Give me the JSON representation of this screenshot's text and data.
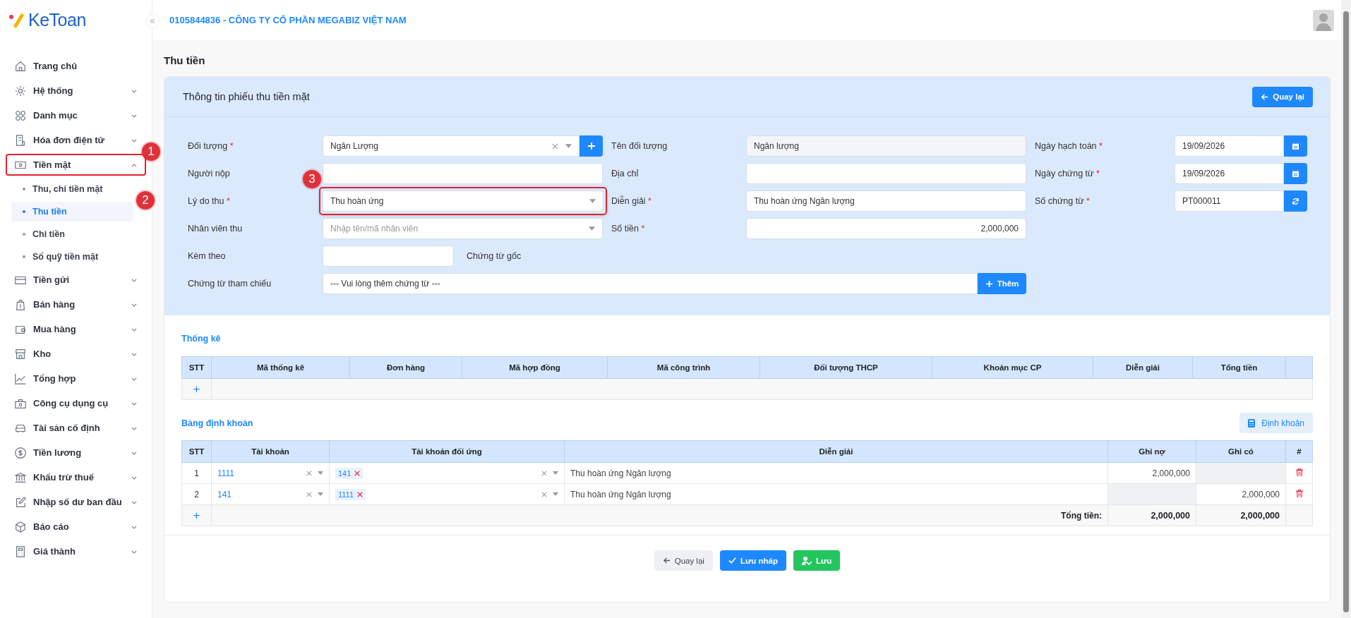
{
  "logo": {
    "text": "KeToan"
  },
  "company": "0105844836 - CÔNG TY CỔ PHẦN MEGABIZ VIỆT NAM",
  "sidebar": {
    "items": [
      {
        "label": "Trang chủ",
        "kind": "link"
      },
      {
        "label": "Hệ thống",
        "kind": "group",
        "expanded": false
      },
      {
        "label": "Danh mục",
        "kind": "group",
        "expanded": false
      },
      {
        "label": "Hóa đơn điện tử",
        "kind": "group",
        "expanded": false
      },
      {
        "label": "Tiền mặt",
        "kind": "group",
        "expanded": true,
        "callout": "1",
        "children": [
          {
            "label": "Thu, chi tiền mặt",
            "selected": false
          },
          {
            "label": "Thu tiền",
            "selected": true,
            "callout": "2"
          },
          {
            "label": "Chi tiền",
            "selected": false
          },
          {
            "label": "Sổ quỹ tiền mặt",
            "selected": false
          }
        ]
      },
      {
        "label": "Tiền gửi",
        "kind": "group",
        "expanded": false
      },
      {
        "label": "Bán hàng",
        "kind": "group",
        "expanded": false
      },
      {
        "label": "Mua hàng",
        "kind": "group",
        "expanded": false
      },
      {
        "label": "Kho",
        "kind": "group",
        "expanded": false
      },
      {
        "label": "Tổng hợp",
        "kind": "group",
        "expanded": false
      },
      {
        "label": "Công cụ dụng cụ",
        "kind": "group",
        "expanded": false
      },
      {
        "label": "Tài sản cố định",
        "kind": "group",
        "expanded": false
      },
      {
        "label": "Tiền lương",
        "kind": "group",
        "expanded": false
      },
      {
        "label": "Khấu trừ thuế",
        "kind": "group",
        "expanded": false
      },
      {
        "label": "Nhập số dư ban đầu",
        "kind": "group",
        "expanded": false
      },
      {
        "label": "Báo cáo",
        "kind": "group",
        "expanded": false
      },
      {
        "label": "Giá thành",
        "kind": "group",
        "expanded": false
      }
    ]
  },
  "page_title": "Thu tiền",
  "card": {
    "title": "Thông tin phiếu thu tiền mặt",
    "back_button": "Quay lại"
  },
  "form": {
    "required_mark": "*",
    "rows": [
      [
        {
          "label": "Đối tượng",
          "required": true,
          "kind": "select_add",
          "value": "Ngân Lượng"
        },
        {
          "label": "Tên đối tượng",
          "required": false,
          "kind": "readonly",
          "value": "Ngân lượng"
        },
        {
          "label": "Ngày hạch toán",
          "required": true,
          "kind": "date",
          "value": "19/09/2026"
        }
      ],
      [
        {
          "label": "Người nộp",
          "required": false,
          "kind": "text"
        },
        {
          "label": "Địa chỉ",
          "required": false,
          "kind": "text"
        },
        {
          "label": "Ngày chứng từ",
          "required": true,
          "kind": "date",
          "value": "19/09/2026"
        }
      ],
      [
        {
          "label": "Lý do thu",
          "required": true,
          "kind": "select",
          "value": "Thu hoàn ứng",
          "callout": "3"
        },
        {
          "label": "Diễn giải",
          "required": true,
          "kind": "text",
          "value": "Thu hoàn ứng Ngân lượng"
        },
        {
          "label": "Số chứng từ",
          "required": true,
          "kind": "code",
          "value": "PT000011"
        }
      ],
      [
        {
          "label": "Nhân viên thu",
          "required": false,
          "kind": "select",
          "placeholder": "Nhập tên/mã nhân viên"
        },
        {
          "label": "Số tiền",
          "required": true,
          "kind": "money",
          "value": "2,000,000"
        }
      ],
      [
        {
          "label": "Kèm theo",
          "required": false,
          "kind": "attach",
          "note": "Chứng từ gốc"
        }
      ],
      [
        {
          "label": "Chứng từ tham chiếu",
          "required": false,
          "kind": "reference",
          "placeholder": "--- Vui lòng thêm chứng từ ---",
          "button": "Thêm"
        }
      ]
    ]
  },
  "stats": {
    "title": "Thống kê",
    "columns": [
      "STT",
      "Mã thống kê",
      "Đơn hàng",
      "Mã hợp đồng",
      "Mã công trình",
      "Đối tượng THCP",
      "Khoản mục CP",
      "Diễn giải",
      "Tổng tiền"
    ],
    "add": "+"
  },
  "entries": {
    "title": "Bảng định khoản",
    "button": "Định khoản",
    "columns": [
      "STT",
      "Tài khoản",
      "Tài khoản đối ứng",
      "Diễn giải",
      "Ghi nợ",
      "Ghi có",
      "#"
    ],
    "rows": [
      {
        "stt": "1",
        "account": "1111",
        "contra": "141",
        "description": "Thu hoàn ứng Ngân lượng",
        "debit": "2,000,000"
      },
      {
        "stt": "2",
        "account": "141",
        "contra": "1111",
        "description": "Thu hoàn ứng Ngân lượng",
        "credit": "2,000,000"
      }
    ],
    "add": "+",
    "footer": {
      "label": "Tổng tiền:",
      "debit": "2,000,000",
      "credit": "2,000,000"
    }
  },
  "actions": [
    {
      "label": "Quay lại",
      "kind": "back"
    },
    {
      "label": "Lưu nháp",
      "kind": "draft"
    },
    {
      "label": "Lưu",
      "kind": "save"
    }
  ]
}
